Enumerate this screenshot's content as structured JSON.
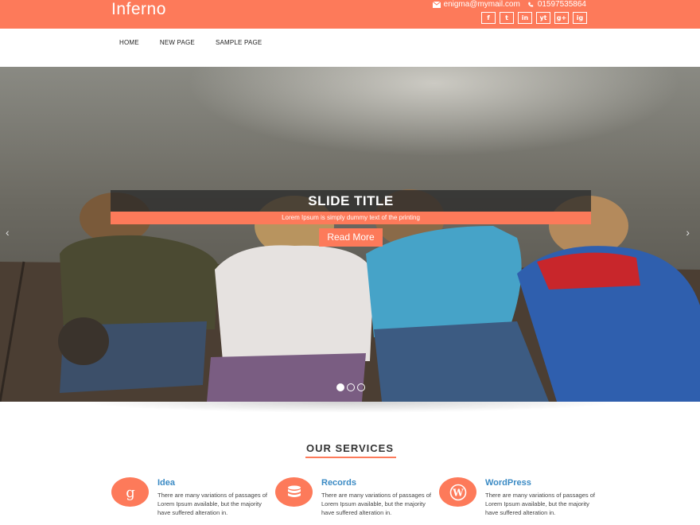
{
  "header": {
    "site_title": "Inferno",
    "email": "enigma@mymail.com",
    "phone": "01597535864",
    "social": [
      "f",
      "t",
      "in",
      "yt",
      "g+",
      "ig"
    ]
  },
  "nav": {
    "items": [
      "HOME",
      "NEW PAGE",
      "SAMPLE PAGE"
    ]
  },
  "slider": {
    "title": "SLIDE TITLE",
    "subtitle": "Lorem Ipsum is simply dummy text of the printing",
    "button": "Read More",
    "prev": "‹",
    "next": "›",
    "dots": 3,
    "active_dot": 1
  },
  "services": {
    "heading": "OUR SERVICES",
    "items": [
      {
        "title": "Idea",
        "text": "There are many variations of passages of Lorem Ipsum available, but the majority have suffered alteration in.",
        "icon": "google-plus-icon"
      },
      {
        "title": "Records",
        "text": "There are many variations of passages of Lorem Ipsum available, but the majority have suffered alteration in.",
        "icon": "database-icon"
      },
      {
        "title": "WordPress",
        "text": "There are many variations of passages of Lorem Ipsum available, but the majority have suffered alteration in.",
        "icon": "wordpress-icon"
      }
    ]
  },
  "colors": {
    "accent": "#fd7a5a",
    "link": "#3a8ac4"
  }
}
